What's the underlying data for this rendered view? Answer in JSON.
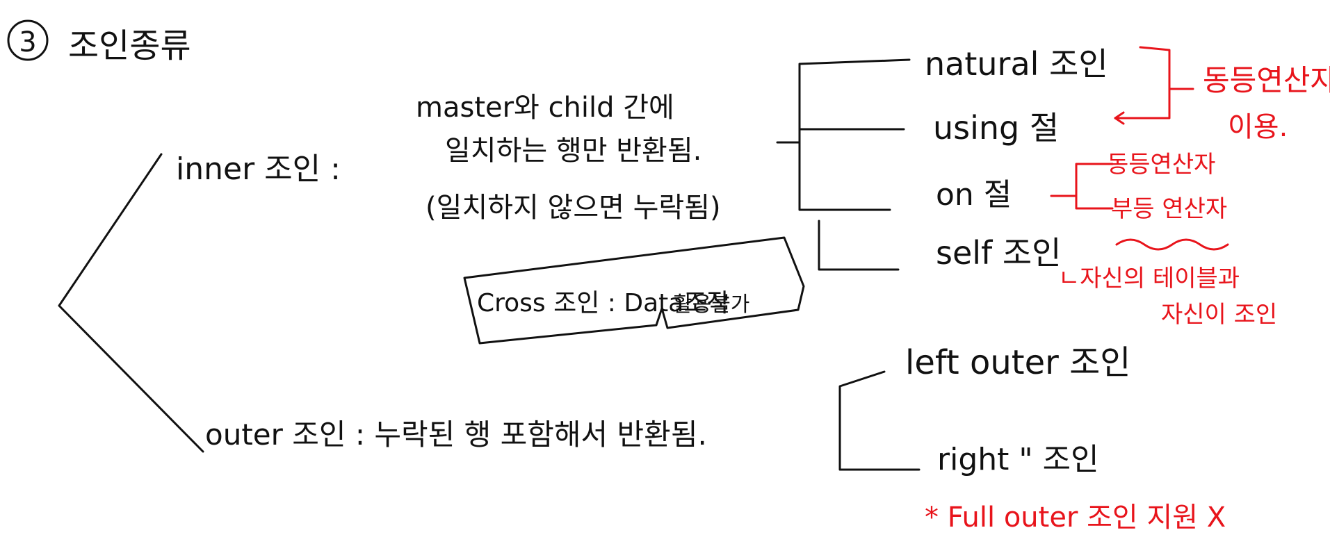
{
  "heading": {
    "number": "3",
    "title": "조인종류"
  },
  "inner": {
    "label": "inner 조인 :",
    "desc_line1": "master와 child 간에",
    "desc_line2": "일치하는 행만 반환됨.",
    "desc_line3": "(일치하지 않으면 누락됨)"
  },
  "cross": {
    "label": "Cross 조인 : Data조작",
    "note": "활용불가"
  },
  "inner_types": {
    "natural": "natural 조인",
    "using": "using 절",
    "on": "on 절",
    "self": "self 조인"
  },
  "outer": {
    "label": "outer 조인 : 누락된 행 포함해서 반환됨.",
    "left": "left outer 조인",
    "right": "right \" 조인"
  },
  "notes": {
    "equi": "동등연산자",
    "equi_use": "이용.",
    "on_equi": "동등연산자",
    "on_nonequi": "부등 연산자",
    "self_desc1": "ㄴ자신의 테이블과",
    "self_desc2": "자신이 조인",
    "full_outer": "* Full outer 조인 지원 X"
  },
  "colors": {
    "ink": "#111111",
    "accent": "#e8141b"
  }
}
